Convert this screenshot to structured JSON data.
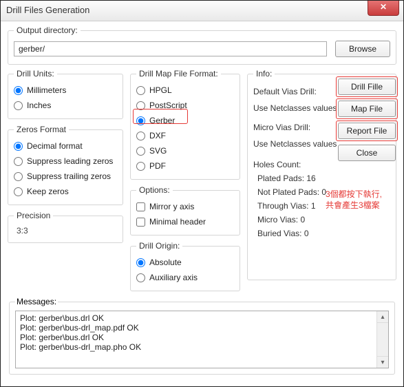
{
  "window": {
    "title": "Drill Files Generation",
    "close_glyph": "✕"
  },
  "output": {
    "legend": "Output directory:",
    "value": "gerber/",
    "browse_label": "Browse"
  },
  "drill_units": {
    "legend": "Drill Units:",
    "opts": [
      "Millimeters",
      "Inches"
    ],
    "selected": 0
  },
  "zeros": {
    "legend": "Zeros Format",
    "opts": [
      "Decimal format",
      "Suppress leading zeros",
      "Suppress trailing zeros",
      "Keep zeros"
    ],
    "selected": 0
  },
  "precision": {
    "legend": "Precision",
    "value": "3:3"
  },
  "map_format": {
    "legend": "Drill Map File Format:",
    "opts": [
      "HPGL",
      "PostScript",
      "Gerber",
      "DXF",
      "SVG",
      "PDF"
    ],
    "selected": 2
  },
  "options": {
    "legend": "Options:",
    "items": [
      {
        "label": "Mirror y axis",
        "checked": false
      },
      {
        "label": "Minimal header",
        "checked": false
      }
    ]
  },
  "drill_origin": {
    "legend": "Drill Origin:",
    "opts": [
      "Absolute",
      "Auxiliary axis"
    ],
    "selected": 0
  },
  "info": {
    "legend": "Info:",
    "default_vias_label": "Default Vias Drill:",
    "default_vias_note": "Use Netclasses values",
    "micro_vias_label": "Micro Vias Drill:",
    "micro_vias_note": "Use Netclasses values",
    "holes_count_label": "Holes Count:",
    "holes": [
      "Plated Pads: 16",
      "Not Plated Pads: 0",
      "Through Vias: 1",
      "Micro Vias: 0",
      "Buried Vias: 0"
    ],
    "buttons": {
      "drill": "Drill Fille",
      "map": "Map File",
      "report": "Report File",
      "close": "Close"
    }
  },
  "annotation": {
    "line1": "3個都按下執行,",
    "line2": "共會產生3檔案"
  },
  "messages": {
    "legend": "Messages:",
    "lines": "Plot: gerber\\bus.drl OK\nPlot: gerber\\bus-drl_map.pdf OK\nPlot: gerber\\bus.drl OK\nPlot: gerber\\bus-drl_map.pho OK"
  }
}
